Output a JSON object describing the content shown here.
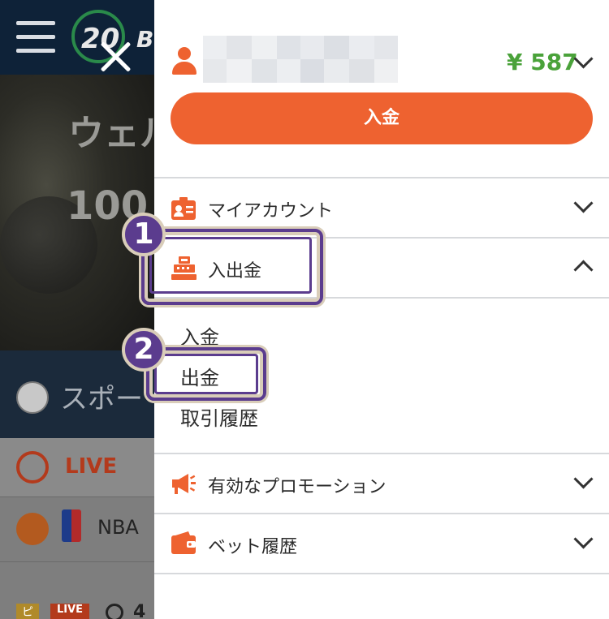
{
  "background": {
    "hero_title": "ウェル",
    "hero_amount": "100",
    "sports_label": "スポー",
    "live_label": "LIVE",
    "nba_label": "NBA",
    "bottom_badge_1": "ピ",
    "bottom_badge_2": "LIVE",
    "bottom_number": "4",
    "logo_text": "20",
    "logo_letter": "B"
  },
  "header": {
    "balance": "¥ 587",
    "deposit_button_label": "入金"
  },
  "menu": {
    "items": [
      {
        "label": "マイアカウント",
        "icon": "id-card-icon",
        "expanded": false
      },
      {
        "label": "入出金",
        "icon": "cash-register-icon",
        "expanded": true
      },
      {
        "label": "有効なプロモーション",
        "icon": "megaphone-icon",
        "expanded": false
      },
      {
        "label": "ベット履歴",
        "icon": "wallet-icon",
        "expanded": false
      }
    ],
    "submenu": [
      "入金",
      "出金",
      "取引履歴"
    ]
  },
  "annotations": {
    "step1": "1",
    "step2": "2"
  },
  "colors": {
    "accent": "#ee6230",
    "balance": "#4aa23a",
    "annotation": "#5b3c8e",
    "annotation_outline": "#d9cdb9",
    "nav_dark": "#0e2238"
  }
}
